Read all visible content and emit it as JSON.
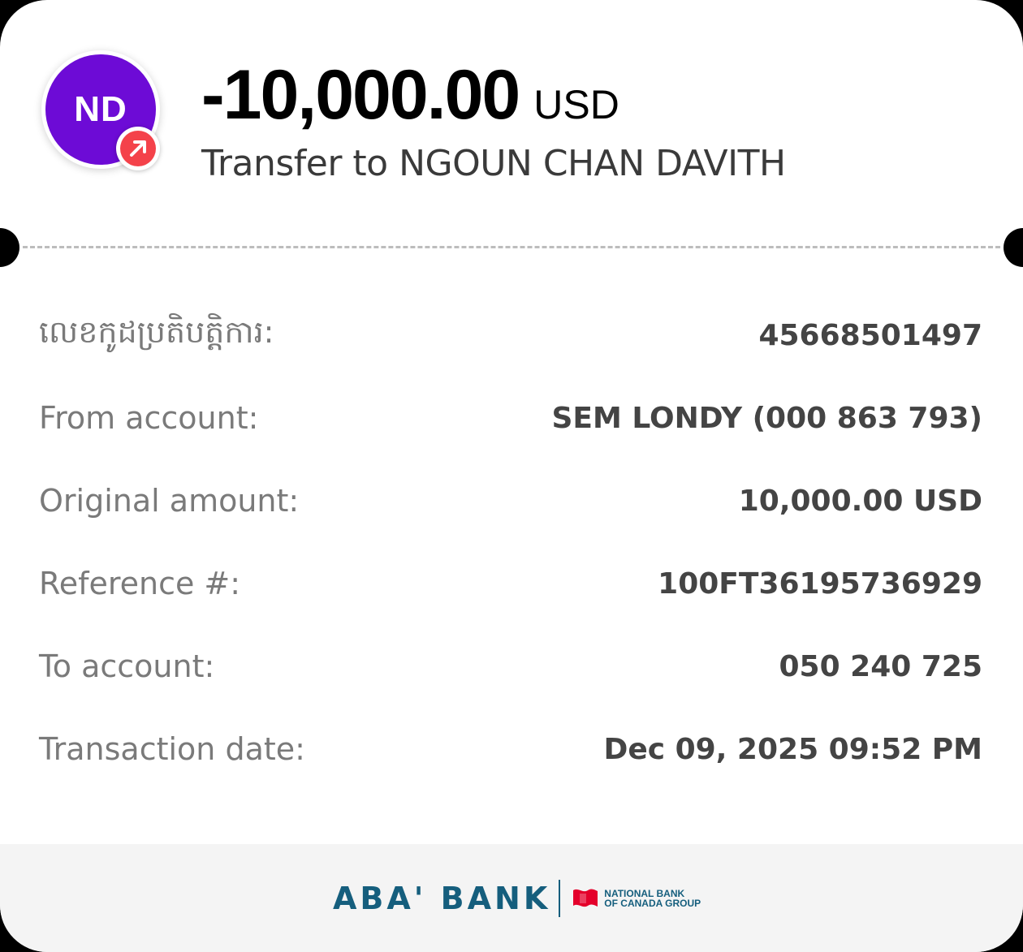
{
  "header": {
    "avatar_initials": "ND",
    "avatar_color": "#6d0bd6",
    "badge_icon": "outgoing-arrow-icon",
    "badge_color": "#f4424a",
    "amount": "-10,000.00",
    "currency": "USD",
    "transfer_label": "Transfer to NGOUN CHAN DAVITH"
  },
  "details": [
    {
      "label": "លេខកូដប្រតិបត្តិការ:",
      "value": "45668501497"
    },
    {
      "label": "From account:",
      "value": "SEM LONDY (000 863 793)"
    },
    {
      "label": "Original amount:",
      "value": "10,000.00 USD"
    },
    {
      "label": "Reference #:",
      "value": "100FT36195736929"
    },
    {
      "label": "To account:",
      "value": "050 240 725"
    },
    {
      "label": "Transaction date:",
      "value": "Dec 09, 2025 09:52 PM"
    }
  ],
  "footer": {
    "bank_name": "ABA' BANK",
    "group_line1": "NATIONAL BANK",
    "group_line2": "OF CANADA GROUP",
    "brand_color": "#155e7d",
    "flag_color": "#e4002b"
  }
}
